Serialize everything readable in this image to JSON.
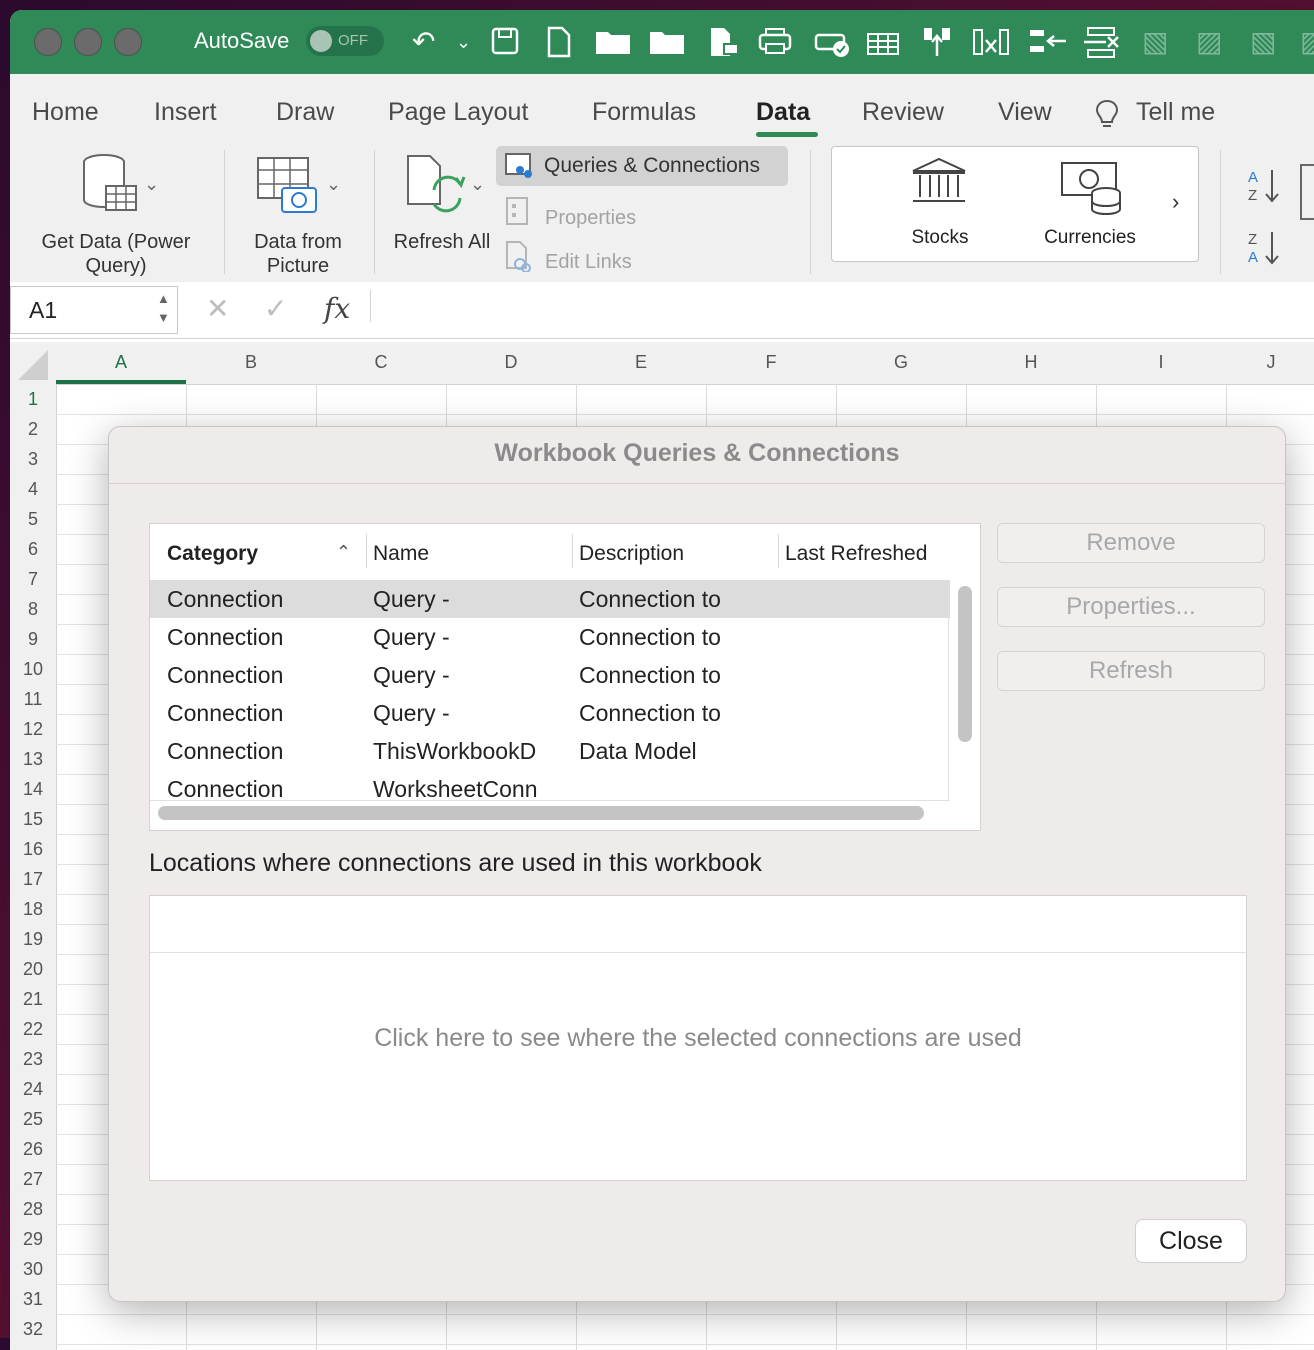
{
  "titlebar": {
    "autosave_label": "AutoSave",
    "autosave_state": "OFF"
  },
  "ribbon_tabs": [
    "Home",
    "Insert",
    "Draw",
    "Page Layout",
    "Formulas",
    "Data",
    "Review",
    "View",
    "Tell me"
  ],
  "active_tab": "Data",
  "ribbon": {
    "get_data": "Get Data (Power Query)",
    "data_from_picture": "Data from Picture",
    "refresh_all": "Refresh All",
    "queries_connections": "Queries & Connections",
    "properties": "Properties",
    "edit_links": "Edit Links",
    "stocks": "Stocks",
    "currencies": "Currencies"
  },
  "formula_bar": {
    "name_box": "A1",
    "fx": "fx"
  },
  "columns": [
    "A",
    "B",
    "C",
    "D",
    "E",
    "F",
    "G",
    "H",
    "I",
    "J"
  ],
  "rows": [
    "1",
    "2",
    "3",
    "4",
    "5",
    "6",
    "7",
    "8",
    "9",
    "10",
    "11",
    "12",
    "13",
    "14",
    "15",
    "16",
    "17",
    "18",
    "19",
    "20",
    "21",
    "22",
    "23",
    "24",
    "25",
    "26",
    "27",
    "28",
    "29",
    "30",
    "31",
    "32"
  ],
  "dialog": {
    "title": "Workbook Queries & Connections",
    "headers": [
      "Category",
      "Name",
      "Description",
      "Last Refreshed"
    ],
    "rows": [
      {
        "category": "Connection",
        "name": "Query -",
        "description": "Connection to",
        "last_refreshed": ""
      },
      {
        "category": "Connection",
        "name": "Query -",
        "description": "Connection to",
        "last_refreshed": ""
      },
      {
        "category": "Connection",
        "name": "Query -",
        "description": "Connection to",
        "last_refreshed": ""
      },
      {
        "category": "Connection",
        "name": "Query -",
        "description": "Connection to",
        "last_refreshed": ""
      },
      {
        "category": "Connection",
        "name": "ThisWorkbookD",
        "description": "Data Model",
        "last_refreshed": ""
      },
      {
        "category": "Connection",
        "name": "WorksheetConn",
        "description": "",
        "last_refreshed": ""
      }
    ],
    "buttons": {
      "remove": "Remove",
      "properties": "Properties...",
      "refresh": "Refresh",
      "close": "Close"
    },
    "locations_label": "Locations where connections are used in this workbook",
    "locations_hint": "Click here to see where the selected connections are used"
  }
}
